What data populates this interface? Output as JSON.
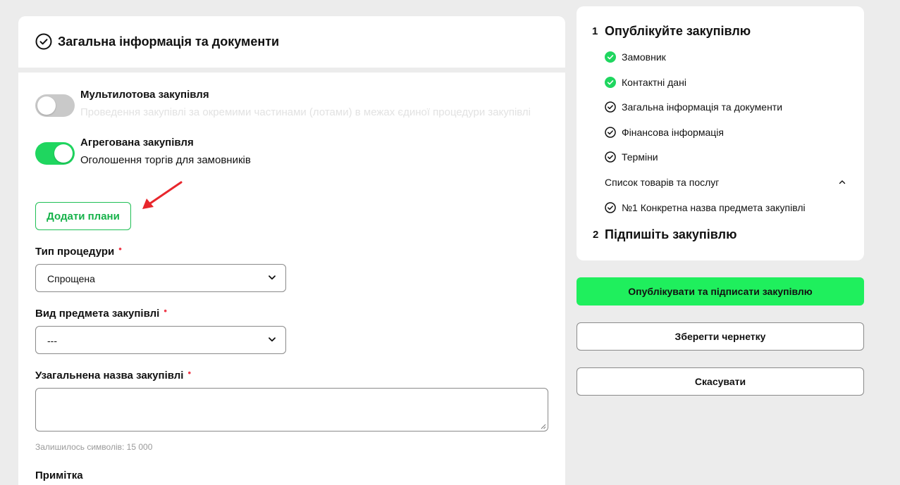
{
  "section": {
    "title": "Загальна інформація та документи",
    "icon": "check-circle-icon"
  },
  "options": {
    "multilot": {
      "title": "Мультилотова закупівля",
      "description": "Проведення закупівлі за окремими частинами (лотами) в межах єдиної процедури закупівлі",
      "enabled": false
    },
    "aggregated": {
      "title": "Агрегована закупівля",
      "description": "Оголошення торгів для замовників",
      "enabled": true
    }
  },
  "add_plans_label": "Додати плани",
  "fields": {
    "procedure_type": {
      "label": "Тип процедури",
      "value": "Спрощена"
    },
    "subject_type": {
      "label": "Вид предмета закупівлі",
      "value": "---"
    },
    "general_name": {
      "label": "Узагальнена назва закупівлі",
      "value": "",
      "hint": "Залишилось символів: 15 000"
    },
    "note": {
      "label": "Примітка"
    }
  },
  "required_mark": "•",
  "steps": [
    {
      "number": "1",
      "title": "Опублікуйте закупівлю",
      "items": [
        {
          "label": "Замовник",
          "status": "done"
        },
        {
          "label": "Контактні дані",
          "status": "done"
        },
        {
          "label": "Загальна інформація та документи",
          "status": "pending"
        },
        {
          "label": "Фінансова інформація",
          "status": "pending"
        },
        {
          "label": "Терміни",
          "status": "pending"
        }
      ],
      "group": {
        "label": "Список товарів та послуг",
        "expanded": true,
        "items": [
          {
            "label": "№1 Конкретна назва предмета закупівлі",
            "status": "pending"
          }
        ]
      }
    },
    {
      "number": "2",
      "title": "Підпишіть закупівлю"
    }
  ],
  "actions": {
    "publish": "Опублікувати та підписати закупівлю",
    "save_draft": "Зберегти чернетку",
    "cancel": "Скасувати"
  },
  "colors": {
    "accent_green": "#1fef5d",
    "done_green": "#1fd65f",
    "required_red": "#ef3b4b",
    "annotation_arrow": "#e8262c"
  }
}
